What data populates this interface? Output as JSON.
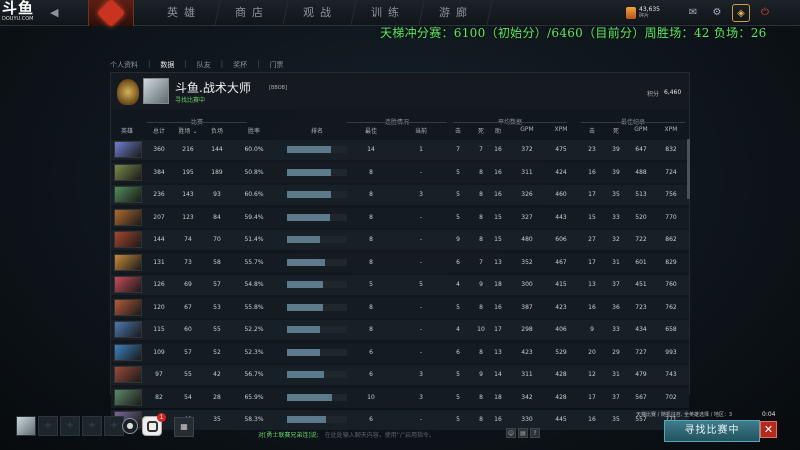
{
  "watermark": {
    "brand": "斗鱼",
    "domain": "DOUYU.COM"
  },
  "topnav": {
    "items": [
      "英雄",
      "商店",
      "观战",
      "训练",
      "游廊"
    ]
  },
  "currency": {
    "amount": "43,635",
    "sub": "碎片"
  },
  "overlay": {
    "text": "天梯冲分赛：6100（初始分）/6460（目前分）周胜场：42 负场：26"
  },
  "subnav": {
    "items": [
      "个人资料",
      "数据",
      "队友",
      "奖杯",
      "门票"
    ],
    "active_index": 1
  },
  "player": {
    "name": "斗鱼.战术大师",
    "tag": "[BBOB]",
    "status": "寻找比赛中",
    "score_label": "积分",
    "score": "6,460"
  },
  "table": {
    "groups": {
      "matches": "比赛",
      "streak": "连胜情况",
      "avg": "平均数据",
      "best": "最佳纪录"
    },
    "columns": {
      "hero": "英雄",
      "total": "总计",
      "wins": "胜场 ⌄",
      "losses": "负场",
      "winrate": "胜率",
      "rank": "排名",
      "best_streak": "最佳",
      "cur_streak": "当前",
      "k": "击",
      "d": "死",
      "a": "助",
      "gpm": "GPM",
      "xpm": "XPM",
      "bk": "击",
      "bd": "死",
      "bgpm": "GPM",
      "bxpm": "XPM"
    },
    "rows": [
      {
        "hero_color": "#6e7fd1",
        "total": "360",
        "wins": "216",
        "losses": "144",
        "winrate": "60.0%",
        "rank_fraction": 0.73,
        "best": "14",
        "cur": "1",
        "k": "7",
        "d": "7",
        "a": "16",
        "gpm": "372",
        "xpm": "475",
        "bk": "23",
        "bd": "39",
        "bgpm": "647",
        "bxpm": "832"
      },
      {
        "hero_color": "#7a8a4a",
        "total": "384",
        "wins": "195",
        "losses": "189",
        "winrate": "50.8%",
        "rank_fraction": 0.73,
        "best": "8",
        "cur": "-",
        "k": "5",
        "d": "8",
        "a": "16",
        "gpm": "311",
        "xpm": "424",
        "bk": "16",
        "bd": "39",
        "bgpm": "488",
        "bxpm": "724"
      },
      {
        "hero_color": "#4f8c5a",
        "total": "236",
        "wins": "143",
        "losses": "93",
        "winrate": "60.6%",
        "rank_fraction": 0.73,
        "best": "8",
        "cur": "3",
        "k": "5",
        "d": "8",
        "a": "16",
        "gpm": "326",
        "xpm": "460",
        "bk": "17",
        "bd": "35",
        "bgpm": "513",
        "bxpm": "756"
      },
      {
        "hero_color": "#b06a2e",
        "total": "207",
        "wins": "123",
        "losses": "84",
        "winrate": "59.4%",
        "rank_fraction": 0.72,
        "best": "8",
        "cur": "-",
        "k": "5",
        "d": "8",
        "a": "15",
        "gpm": "327",
        "xpm": "443",
        "bk": "15",
        "bd": "33",
        "bgpm": "520",
        "bxpm": "770"
      },
      {
        "hero_color": "#a8442c",
        "total": "144",
        "wins": "74",
        "losses": "70",
        "winrate": "51.4%",
        "rank_fraction": 0.55,
        "best": "8",
        "cur": "-",
        "k": "9",
        "d": "8",
        "a": "15",
        "gpm": "480",
        "xpm": "606",
        "bk": "27",
        "bd": "32",
        "bgpm": "722",
        "bxpm": "862"
      },
      {
        "hero_color": "#c88a3a",
        "total": "131",
        "wins": "73",
        "losses": "58",
        "winrate": "55.7%",
        "rank_fraction": 0.63,
        "best": "8",
        "cur": "-",
        "k": "6",
        "d": "7",
        "a": "13",
        "gpm": "352",
        "xpm": "467",
        "bk": "17",
        "bd": "31",
        "bgpm": "601",
        "bxpm": "829"
      },
      {
        "hero_color": "#c84a5a",
        "total": "126",
        "wins": "69",
        "losses": "57",
        "winrate": "54.8%",
        "rank_fraction": 0.6,
        "best": "5",
        "cur": "5",
        "k": "4",
        "d": "9",
        "a": "18",
        "gpm": "300",
        "xpm": "415",
        "bk": "13",
        "bd": "37",
        "bgpm": "451",
        "bxpm": "760"
      },
      {
        "hero_color": "#b35a3a",
        "total": "120",
        "wins": "67",
        "losses": "53",
        "winrate": "55.8%",
        "rank_fraction": 0.6,
        "best": "8",
        "cur": "-",
        "k": "5",
        "d": "8",
        "a": "16",
        "gpm": "387",
        "xpm": "423",
        "bk": "16",
        "bd": "36",
        "bgpm": "723",
        "bxpm": "762"
      },
      {
        "hero_color": "#4a7ab0",
        "total": "115",
        "wins": "60",
        "losses": "55",
        "winrate": "52.2%",
        "rank_fraction": 0.55,
        "best": "8",
        "cur": "-",
        "k": "4",
        "d": "10",
        "a": "17",
        "gpm": "298",
        "xpm": "406",
        "bk": "9",
        "bd": "33",
        "bgpm": "434",
        "bxpm": "658"
      },
      {
        "hero_color": "#3a82c0",
        "total": "109",
        "wins": "57",
        "losses": "52",
        "winrate": "52.3%",
        "rank_fraction": 0.55,
        "best": "6",
        "cur": "-",
        "k": "6",
        "d": "8",
        "a": "13",
        "gpm": "423",
        "xpm": "529",
        "bk": "20",
        "bd": "29",
        "bgpm": "727",
        "bxpm": "993"
      },
      {
        "hero_color": "#9a4a3a",
        "total": "97",
        "wins": "55",
        "losses": "42",
        "winrate": "56.7%",
        "rank_fraction": 0.62,
        "best": "6",
        "cur": "3",
        "k": "5",
        "d": "9",
        "a": "14",
        "gpm": "311",
        "xpm": "428",
        "bk": "12",
        "bd": "31",
        "bgpm": "479",
        "bxpm": "743"
      },
      {
        "hero_color": "#5a8a6a",
        "total": "82",
        "wins": "54",
        "losses": "28",
        "winrate": "65.9%",
        "rank_fraction": 0.75,
        "best": "10",
        "cur": "3",
        "k": "5",
        "d": "8",
        "a": "18",
        "gpm": "342",
        "xpm": "428",
        "bk": "17",
        "bd": "37",
        "bgpm": "567",
        "bxpm": "702"
      },
      {
        "hero_color": "#7a6a9a",
        "total": "84",
        "wins": "49",
        "losses": "35",
        "winrate": "58.3%",
        "rank_fraction": 0.65,
        "best": "6",
        "cur": "-",
        "k": "5",
        "d": "8",
        "a": "16",
        "gpm": "330",
        "xpm": "445",
        "bk": "16",
        "bd": "35",
        "bgpm": "557",
        "bxpm": "771"
      }
    ]
  },
  "bottom": {
    "notif_count": "1",
    "chat_who": "对[勇士联赛兄弟连]说:",
    "chat_hint": "在此处输入聊天内容，使用“/”启用指令。",
    "search_info": "天梯比赛 / 随机征召, 全英雄选择 / 地区：3",
    "timer": "0:04",
    "search_button": "寻找比赛中",
    "cancel_glyph": "✕",
    "help_glyph": "?"
  }
}
